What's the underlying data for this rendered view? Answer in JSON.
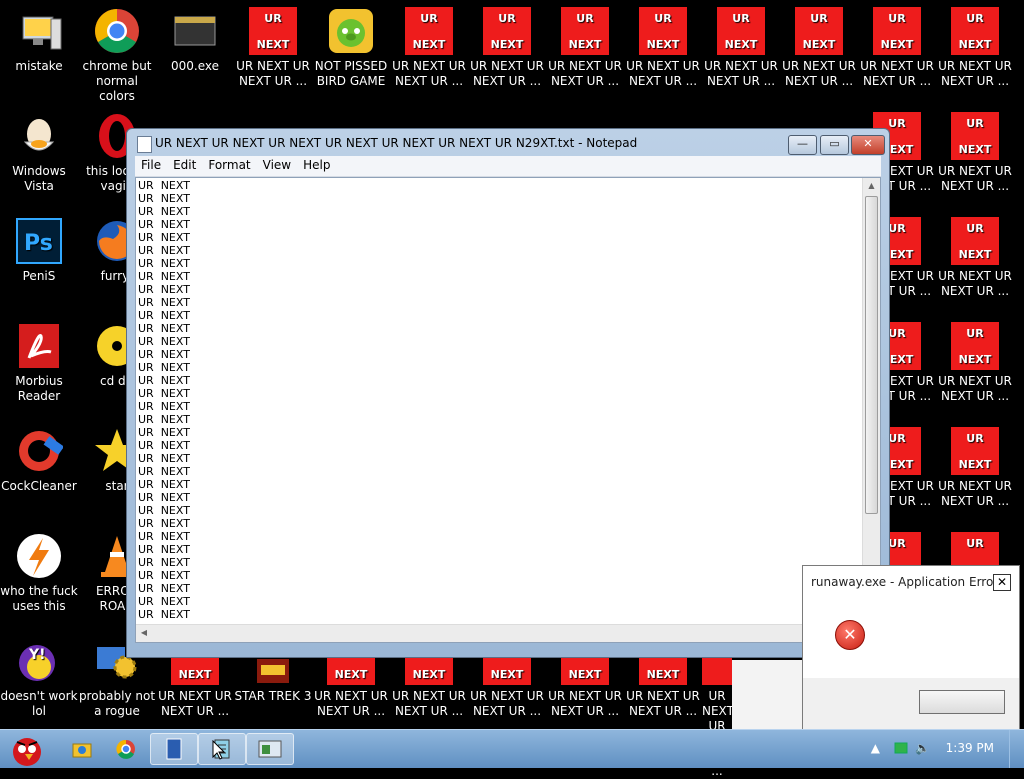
{
  "desktop": {
    "left_icons": [
      {
        "name": "mistake",
        "label": "mistake"
      },
      {
        "name": "chrome",
        "label": "chrome but normal colors"
      },
      {
        "name": "000exe",
        "label": "000.exe"
      },
      {
        "name": "bird-game",
        "label": "NOT PISSED BIRD GAME"
      },
      {
        "name": "windows-vista",
        "label": "Windows Vista"
      },
      {
        "name": "this-look",
        "label": "this look a vagin"
      },
      {
        "name": "penis",
        "label": "PeniS"
      },
      {
        "name": "furryf",
        "label": "furryf"
      },
      {
        "name": "morbius-reader",
        "label": "Morbius Reader"
      },
      {
        "name": "cd-dri",
        "label": "cd dri"
      },
      {
        "name": "cockcleaner",
        "label": "CockCleaner"
      },
      {
        "name": "star",
        "label": "star"
      },
      {
        "name": "who-uses",
        "label": "who the fuck uses this"
      },
      {
        "name": "error-road",
        "label": "ERROR ROAD"
      },
      {
        "name": "yahoo",
        "label": "doesn't work lol"
      },
      {
        "name": "rogue",
        "label": "probably not a rogue"
      },
      {
        "name": "star-trek",
        "label": "STAR TREK 3"
      }
    ],
    "tile_top": "UR",
    "tile_bottom": "NEXT",
    "tile_label": "UR NEXT UR NEXT UR ...",
    "colors": {
      "tile_red": "#ee1c1c"
    }
  },
  "notepad": {
    "title": "UR NEXT UR NEXT UR NEXT UR NEXT UR NEXT UR NEXT UR N29XT.txt - Notepad",
    "menu": [
      "File",
      "Edit",
      "Format",
      "View",
      "Help"
    ],
    "line_text": "UR  NEXT",
    "line_count": 34
  },
  "error_dialog": {
    "title": "runaway.exe - Application Error",
    "close": "✕"
  },
  "taskbar": {
    "clock": "1:39 PM",
    "items": [
      "angry-birds-start",
      "explorer",
      "chrome",
      "app",
      "notepad",
      "window"
    ]
  }
}
